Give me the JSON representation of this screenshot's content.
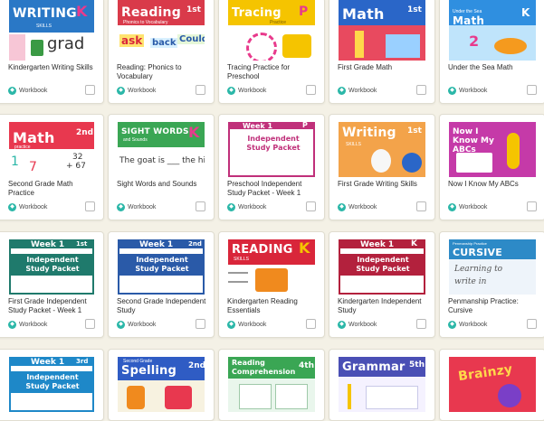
{
  "catalog": {
    "type_label": "Workbook",
    "type_icon": "workbook-icon",
    "colors": {
      "accent": "#2bb7a8",
      "background": "#f4f1e6"
    },
    "items": [
      {
        "id": "kindergarten-writing-skills",
        "title": "Kindergarten Writing Skills",
        "cover": {
          "heading": "WRITING",
          "sub": "SKILLS",
          "badge": "K",
          "extra": "grad",
          "band_color": "#2a78c6"
        }
      },
      {
        "id": "reading-phonics",
        "title": "Reading: Phonics to Vocabulary",
        "cover": {
          "heading": "Reading",
          "sub": "Phonics to Vocabulary",
          "badge": "1st",
          "badge_sub": "GRADE",
          "letters": [
            "ask",
            "back",
            "Could"
          ],
          "band_color": "#d93a4a"
        }
      },
      {
        "id": "tracing-practice",
        "title": "Tracing Practice for Preschool",
        "cover": {
          "heading": "Tracing",
          "sub": "Practice",
          "badge": "P",
          "band_color": "#f5c400"
        }
      },
      {
        "id": "first-grade-math",
        "title": "First Grade Math",
        "cover": {
          "heading": "Math",
          "badge": "1st",
          "badge_sub": "GRADE",
          "band_color": "#2a66c8"
        }
      },
      {
        "id": "under-the-sea-math",
        "title": "Under the Sea Math",
        "cover": {
          "heading": "Math",
          "sub": "Under the Sea",
          "badge": "K",
          "numbers": "2",
          "band_color": "#2f8fe0"
        }
      },
      {
        "id": "second-grade-math",
        "title": "Second Grade Math Practice",
        "cover": {
          "heading": "Math",
          "sub": "practice",
          "badge": "2nd",
          "badge_sub": "GRADE",
          "problem_a": "32",
          "problem_b": "+ 67",
          "digits": [
            "1",
            "7"
          ],
          "band_color": "#e8384f"
        }
      },
      {
        "id": "sight-words",
        "title": "Sight Words and Sounds",
        "cover": {
          "heading": "SIGHT WORDS",
          "sub": "and Sounds",
          "badge": "K",
          "sentence": "The goat is ___ the hill.",
          "band_color": "#3aa654"
        }
      },
      {
        "id": "preschool-independent-week1",
        "title": "Preschool Independent Study Packet - Week 1",
        "cover": {
          "week": "Week 1",
          "heading": "Independent Study Packet",
          "badge": "P",
          "band_color": "#c0307a"
        }
      },
      {
        "id": "first-grade-writing",
        "title": "First Grade Writing Skills",
        "cover": {
          "heading": "Writing",
          "sub": "SKILLS",
          "badge": "1st",
          "badge_sub": "GRADE",
          "band_color": "#f08a1e"
        }
      },
      {
        "id": "now-i-know-my-abcs",
        "title": "Now I Know My ABCs",
        "cover": {
          "heading": "Now I Know My ABCs",
          "band_color": "#c53aa8"
        }
      },
      {
        "id": "first-grade-independent-week1",
        "title": "First Grade Independent Study Packet - Week 1",
        "cover": {
          "week": "Week 1",
          "heading": "Independent Study Packet",
          "badge": "1st",
          "band_color": "#1f7a6c"
        }
      },
      {
        "id": "second-grade-independent",
        "title": "Second Grade Independent Study",
        "cover": {
          "week": "Week 1",
          "heading": "Independent Study Packet",
          "badge": "2nd",
          "band_color": "#2a5aa8"
        }
      },
      {
        "id": "kindergarten-reading-essentials",
        "title": "Kindergarten Reading Essentials",
        "cover": {
          "heading": "READING",
          "sub": "SKILLS",
          "badge": "K",
          "band_color": "#d9263a"
        }
      },
      {
        "id": "kindergarten-independent",
        "title": "Kindergarten Independent Study",
        "cover": {
          "week": "Week 1",
          "heading": "Independent Study Packet",
          "badge": "K",
          "band_color": "#b3213d"
        }
      },
      {
        "id": "penmanship-cursive",
        "title": "Penmanship Practice: Cursive",
        "cover": {
          "heading": "CURSIVE",
          "sub": "Penmanship Practice",
          "lines": [
            "Learning to",
            "write in"
          ],
          "band_color": "#2d8ac7"
        }
      },
      {
        "id": "third-grade-independent",
        "title": "",
        "cover": {
          "week": "Week 1",
          "heading": "Independent Study Packet",
          "badge": "3rd",
          "band_color": "#1e88c8"
        }
      },
      {
        "id": "second-grade-spelling",
        "title": "",
        "cover": {
          "heading": "Spelling",
          "sub": "Second Grade",
          "badge": "2nd",
          "badge_sub": "GRADE",
          "band_color": "#2f5cc4"
        }
      },
      {
        "id": "reading-comprehension-4th",
        "title": "",
        "cover": {
          "heading": "Reading Comprehension",
          "badge": "4th",
          "badge_sub": "GRADE",
          "band_color": "#3aa654"
        }
      },
      {
        "id": "grammar-5th",
        "title": "",
        "cover": {
          "heading": "Grammar",
          "badge": "5th",
          "badge_sub": "GRADE",
          "band_color": "#4a4fb5"
        }
      },
      {
        "id": "brainzy",
        "title": "",
        "cover": {
          "heading": "Brainzy",
          "band_color": "#e8384f"
        }
      }
    ]
  }
}
